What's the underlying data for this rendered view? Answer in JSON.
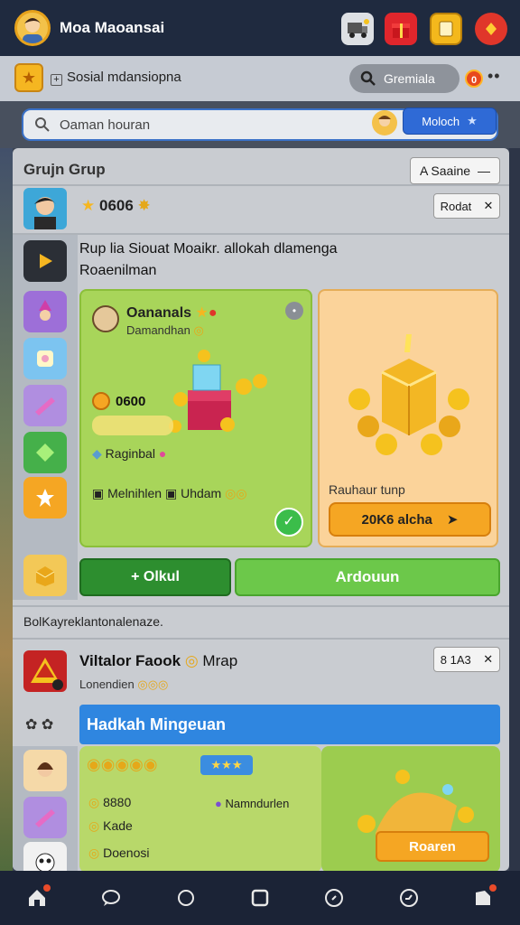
{
  "topbar": {
    "title": "Moa Maoansai",
    "icons": [
      "profile-avatar",
      "truck-icon",
      "gift-icon",
      "card-icon",
      "gem-icon"
    ]
  },
  "secbar": {
    "title": "Sosial mdansiopna",
    "search_pill": "Gremiala",
    "notif_count": "0",
    "more": "••"
  },
  "searchrow": {
    "placeholder": "Oaman houran",
    "button": "Moloch"
  },
  "group": {
    "title": "Grujn Grup",
    "dropdown": "A Saaine",
    "stars_value": "0606",
    "about_btn": "Rodat",
    "description": "Rup lia Siouat Moaikr. allokah dlamenga",
    "description2": "Roaenilman"
  },
  "green_card": {
    "name": "Oananals",
    "subtitle": "Damandhan",
    "coins": "0600",
    "reg_label": "Raginbal",
    "mk1": "Melnihlen",
    "mk2": "Uhdam"
  },
  "orange_card": {
    "label": "Rauhaur tunp",
    "button": "20K6 alcha"
  },
  "buttons": {
    "left": "+ Olkul",
    "right": "Ardouun"
  },
  "section_label": "BolKayreklantonalenaze.",
  "row5": {
    "title": "Viltalor Faook",
    "title_suffix": "Mrap",
    "subtitle": "Lonendien",
    "btn": "8 1A3"
  },
  "blue_header": "Hadkah Mingeuan",
  "bottom_card": {
    "stars": "★★★",
    "l1": "8880",
    "l2": "Kade",
    "l3": "Doenosi",
    "right_label": "Namndurlen",
    "reason_btn": "Roaren"
  },
  "nav": [
    "home",
    "chat",
    "circle",
    "square",
    "compass",
    "clock",
    "profile"
  ],
  "colors": {
    "accent": "#2f86e0",
    "green": "#6cc84a",
    "orange": "#f5a623",
    "topbar": "#1f2a3f"
  }
}
